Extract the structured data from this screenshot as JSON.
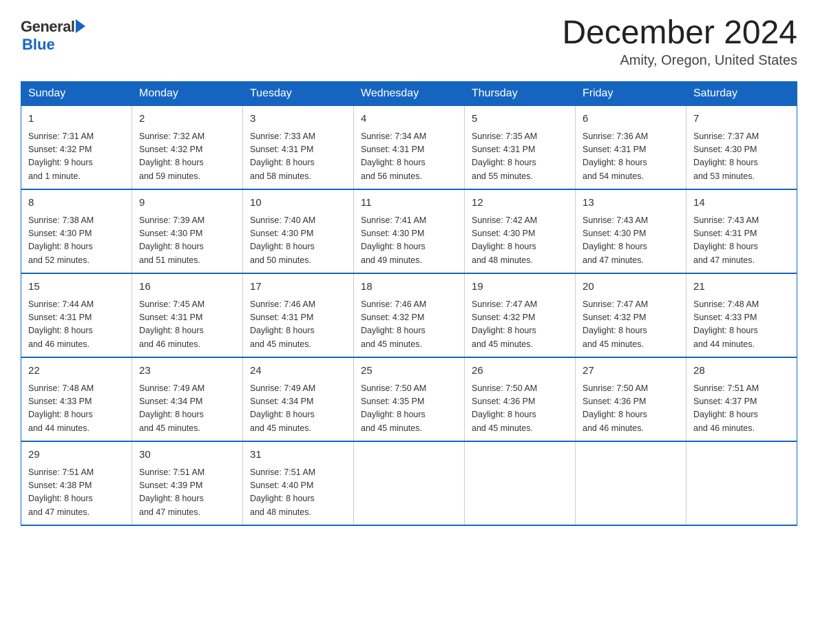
{
  "logo": {
    "general": "General",
    "blue": "Blue"
  },
  "title": {
    "month": "December 2024",
    "location": "Amity, Oregon, United States"
  },
  "days_of_week": [
    "Sunday",
    "Monday",
    "Tuesday",
    "Wednesday",
    "Thursday",
    "Friday",
    "Saturday"
  ],
  "weeks": [
    [
      {
        "day": "1",
        "sunrise": "7:31 AM",
        "sunset": "4:32 PM",
        "daylight": "9 hours and 1 minute."
      },
      {
        "day": "2",
        "sunrise": "7:32 AM",
        "sunset": "4:32 PM",
        "daylight": "8 hours and 59 minutes."
      },
      {
        "day": "3",
        "sunrise": "7:33 AM",
        "sunset": "4:31 PM",
        "daylight": "8 hours and 58 minutes."
      },
      {
        "day": "4",
        "sunrise": "7:34 AM",
        "sunset": "4:31 PM",
        "daylight": "8 hours and 56 minutes."
      },
      {
        "day": "5",
        "sunrise": "7:35 AM",
        "sunset": "4:31 PM",
        "daylight": "8 hours and 55 minutes."
      },
      {
        "day": "6",
        "sunrise": "7:36 AM",
        "sunset": "4:31 PM",
        "daylight": "8 hours and 54 minutes."
      },
      {
        "day": "7",
        "sunrise": "7:37 AM",
        "sunset": "4:30 PM",
        "daylight": "8 hours and 53 minutes."
      }
    ],
    [
      {
        "day": "8",
        "sunrise": "7:38 AM",
        "sunset": "4:30 PM",
        "daylight": "8 hours and 52 minutes."
      },
      {
        "day": "9",
        "sunrise": "7:39 AM",
        "sunset": "4:30 PM",
        "daylight": "8 hours and 51 minutes."
      },
      {
        "day": "10",
        "sunrise": "7:40 AM",
        "sunset": "4:30 PM",
        "daylight": "8 hours and 50 minutes."
      },
      {
        "day": "11",
        "sunrise": "7:41 AM",
        "sunset": "4:30 PM",
        "daylight": "8 hours and 49 minutes."
      },
      {
        "day": "12",
        "sunrise": "7:42 AM",
        "sunset": "4:30 PM",
        "daylight": "8 hours and 48 minutes."
      },
      {
        "day": "13",
        "sunrise": "7:43 AM",
        "sunset": "4:30 PM",
        "daylight": "8 hours and 47 minutes."
      },
      {
        "day": "14",
        "sunrise": "7:43 AM",
        "sunset": "4:31 PM",
        "daylight": "8 hours and 47 minutes."
      }
    ],
    [
      {
        "day": "15",
        "sunrise": "7:44 AM",
        "sunset": "4:31 PM",
        "daylight": "8 hours and 46 minutes."
      },
      {
        "day": "16",
        "sunrise": "7:45 AM",
        "sunset": "4:31 PM",
        "daylight": "8 hours and 46 minutes."
      },
      {
        "day": "17",
        "sunrise": "7:46 AM",
        "sunset": "4:31 PM",
        "daylight": "8 hours and 45 minutes."
      },
      {
        "day": "18",
        "sunrise": "7:46 AM",
        "sunset": "4:32 PM",
        "daylight": "8 hours and 45 minutes."
      },
      {
        "day": "19",
        "sunrise": "7:47 AM",
        "sunset": "4:32 PM",
        "daylight": "8 hours and 45 minutes."
      },
      {
        "day": "20",
        "sunrise": "7:47 AM",
        "sunset": "4:32 PM",
        "daylight": "8 hours and 45 minutes."
      },
      {
        "day": "21",
        "sunrise": "7:48 AM",
        "sunset": "4:33 PM",
        "daylight": "8 hours and 44 minutes."
      }
    ],
    [
      {
        "day": "22",
        "sunrise": "7:48 AM",
        "sunset": "4:33 PM",
        "daylight": "8 hours and 44 minutes."
      },
      {
        "day": "23",
        "sunrise": "7:49 AM",
        "sunset": "4:34 PM",
        "daylight": "8 hours and 45 minutes."
      },
      {
        "day": "24",
        "sunrise": "7:49 AM",
        "sunset": "4:34 PM",
        "daylight": "8 hours and 45 minutes."
      },
      {
        "day": "25",
        "sunrise": "7:50 AM",
        "sunset": "4:35 PM",
        "daylight": "8 hours and 45 minutes."
      },
      {
        "day": "26",
        "sunrise": "7:50 AM",
        "sunset": "4:36 PM",
        "daylight": "8 hours and 45 minutes."
      },
      {
        "day": "27",
        "sunrise": "7:50 AM",
        "sunset": "4:36 PM",
        "daylight": "8 hours and 46 minutes."
      },
      {
        "day": "28",
        "sunrise": "7:51 AM",
        "sunset": "4:37 PM",
        "daylight": "8 hours and 46 minutes."
      }
    ],
    [
      {
        "day": "29",
        "sunrise": "7:51 AM",
        "sunset": "4:38 PM",
        "daylight": "8 hours and 47 minutes."
      },
      {
        "day": "30",
        "sunrise": "7:51 AM",
        "sunset": "4:39 PM",
        "daylight": "8 hours and 47 minutes."
      },
      {
        "day": "31",
        "sunrise": "7:51 AM",
        "sunset": "4:40 PM",
        "daylight": "8 hours and 48 minutes."
      },
      null,
      null,
      null,
      null
    ]
  ],
  "labels": {
    "sunrise": "Sunrise:",
    "sunset": "Sunset:",
    "daylight": "Daylight:"
  }
}
